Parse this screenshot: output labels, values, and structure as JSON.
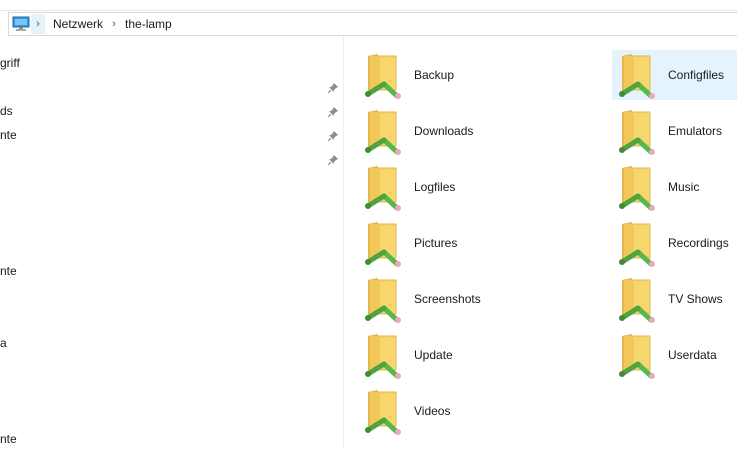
{
  "address": {
    "crumbs": [
      "Netzwerk",
      "the-lamp"
    ]
  },
  "sidebar": {
    "items": [
      {
        "label": "griff"
      },
      {
        "label": "ds"
      },
      {
        "label": "nte"
      },
      {
        "label": "nte"
      },
      {
        "label": "a"
      },
      {
        "label": "nte"
      }
    ]
  },
  "folders": [
    {
      "label": "Backup",
      "selected": false
    },
    {
      "label": "Configfiles",
      "selected": true
    },
    {
      "label": "Downloads",
      "selected": false
    },
    {
      "label": "Emulators",
      "selected": false
    },
    {
      "label": "Logfiles",
      "selected": false
    },
    {
      "label": "Music",
      "selected": false
    },
    {
      "label": "Pictures",
      "selected": false
    },
    {
      "label": "Recordings",
      "selected": false
    },
    {
      "label": "Screenshots",
      "selected": false
    },
    {
      "label": "TV Shows",
      "selected": false
    },
    {
      "label": "Update",
      "selected": false
    },
    {
      "label": "Userdata",
      "selected": false
    },
    {
      "label": "Videos",
      "selected": false
    }
  ],
  "colors": {
    "folder": "#f7d66c",
    "share_pipe": "#5ab84a",
    "selection": "#e5f3ff"
  },
  "icons": {
    "address": "computer-icon",
    "separator": "chevron-right-icon",
    "pin": "pin-icon",
    "folder": "network-share-folder-icon"
  }
}
